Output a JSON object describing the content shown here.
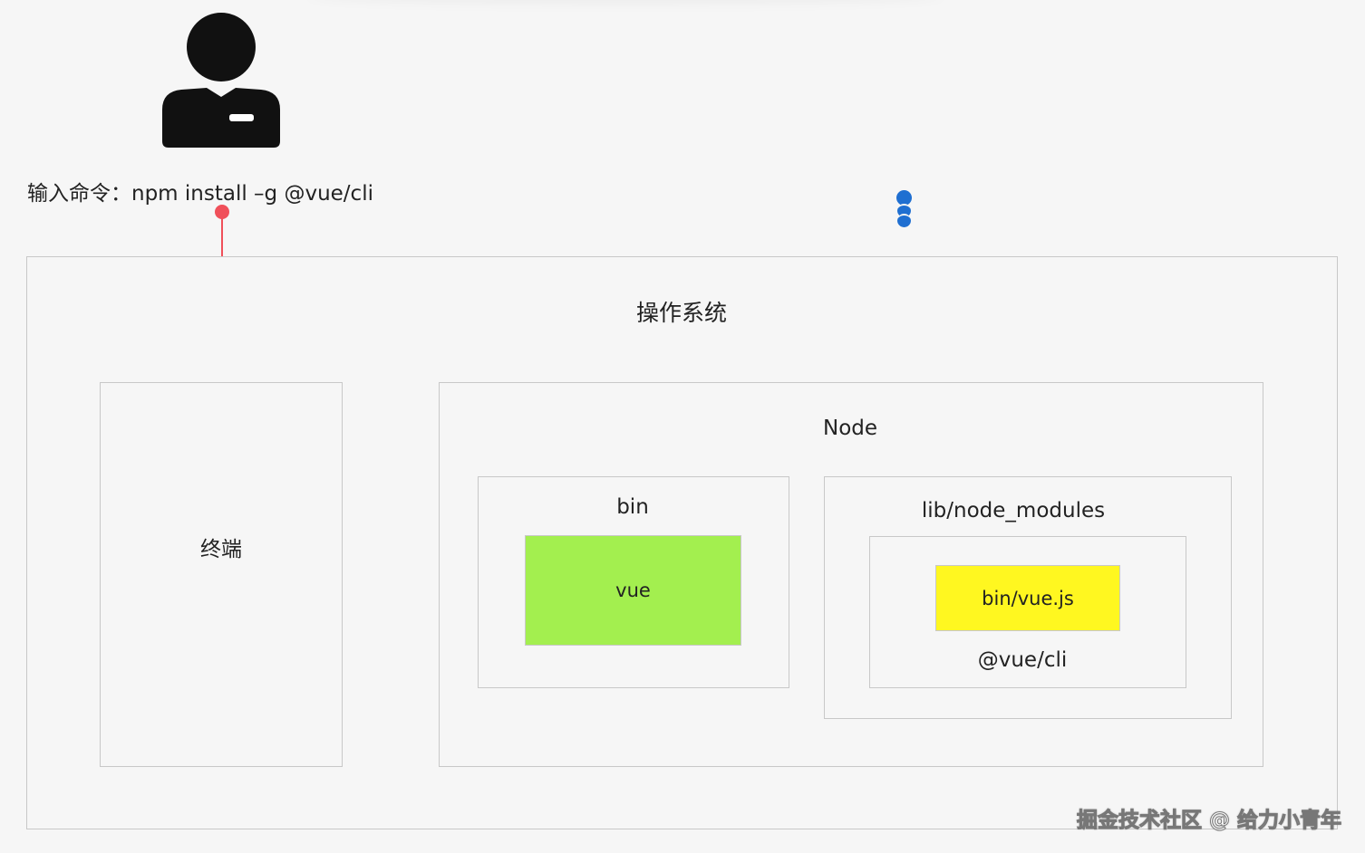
{
  "user": {
    "icon": "user-icon"
  },
  "command": {
    "text": "输入命令：npm install –g @vue/cli"
  },
  "os": {
    "title": "操作系统"
  },
  "terminal": {
    "label": "终端"
  },
  "node": {
    "title": "Node",
    "bin": {
      "title": "bin",
      "vue": "vue"
    },
    "lib": {
      "title": "lib/node_modules",
      "package": {
        "file": "bin/vue.js",
        "name": "@vue/cli"
      }
    }
  },
  "watermark": {
    "text": "掘金技术社区 @ 给力小青年"
  },
  "colors": {
    "arrow": "#f0505a",
    "vue_fill": "#a3ef4f",
    "vuejs_fill": "#fff720",
    "handle": "#1f6fd1",
    "border": "#c8c8c8"
  }
}
